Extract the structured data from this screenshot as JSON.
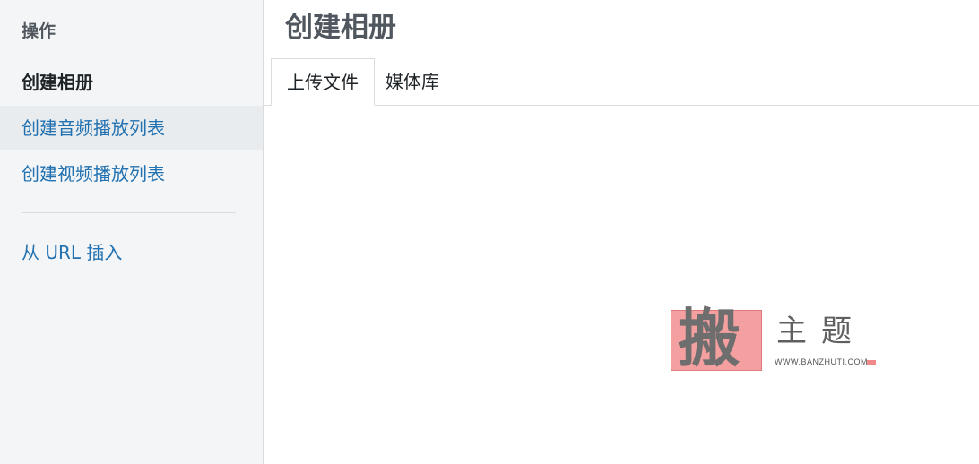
{
  "sidebar": {
    "heading": "操作",
    "items": [
      {
        "label": "创建相册",
        "state": "active"
      },
      {
        "label": "创建音频播放列表",
        "state": "hover"
      },
      {
        "label": "创建视频播放列表",
        "state": "normal"
      }
    ],
    "insert_from_url": "从 URL 插入"
  },
  "main": {
    "title": "创建相册",
    "tabs": [
      {
        "label": "上传文件",
        "active": true
      },
      {
        "label": "媒体库",
        "active": false
      }
    ]
  },
  "watermark": {
    "stamp_char": "搬",
    "title": "主题",
    "url": "WWW.BANZHUTI.COM"
  },
  "colors": {
    "link": "#2271b1",
    "sidebar_bg": "#f3f5f6",
    "hover_bg": "#e9ecee",
    "heading_text": "#50575e",
    "stamp": "#f4a0a0"
  }
}
